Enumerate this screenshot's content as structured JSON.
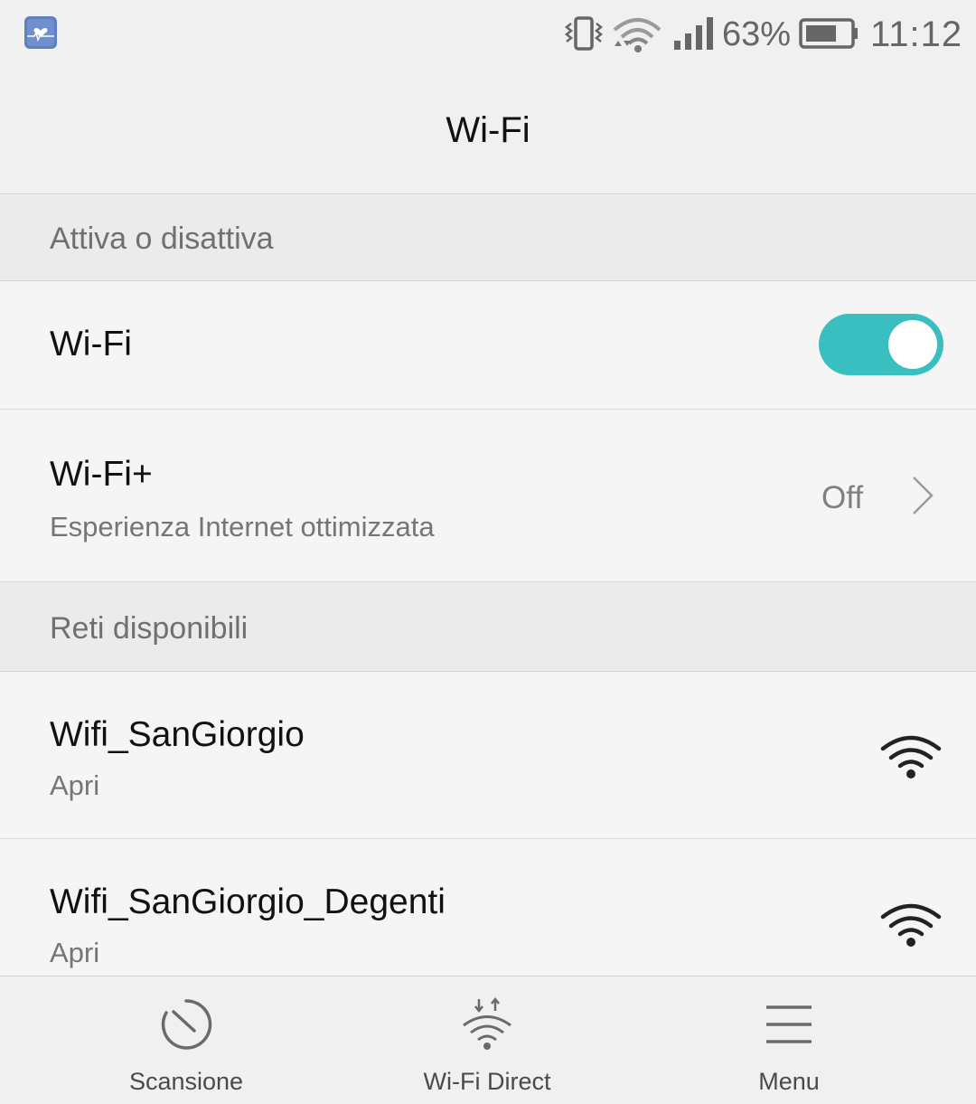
{
  "status_bar": {
    "battery_percent": "63%",
    "time": "11:12",
    "icons": [
      "health-app-icon",
      "vibrate-icon",
      "wifi-status-icon",
      "cell-signal-icon",
      "battery-icon"
    ]
  },
  "header": {
    "title": "Wi-Fi"
  },
  "section_toggle": {
    "label": "Attiva o disattiva"
  },
  "wifi_row": {
    "label": "Wi-Fi",
    "enabled": true,
    "toggle_color": "#39bfbf"
  },
  "wifiplus_row": {
    "label": "Wi-Fi+",
    "subtitle": "Esperienza Internet ottimizzata",
    "value": "Off"
  },
  "section_networks": {
    "label": "Reti disponibili"
  },
  "networks": [
    {
      "ssid": "Wifi_SanGiorgio",
      "security": "Apri",
      "icon": "wifi-signal-icon"
    },
    {
      "ssid": "Wifi_SanGiorgio_Degenti",
      "security": "Apri",
      "icon": "wifi-signal-icon"
    }
  ],
  "bottom_bar": {
    "items": [
      {
        "label": "Scansione",
        "icon": "scan-icon"
      },
      {
        "label": "Wi-Fi Direct",
        "icon": "wifi-direct-icon"
      },
      {
        "label": "Menu",
        "icon": "menu-icon"
      }
    ]
  }
}
